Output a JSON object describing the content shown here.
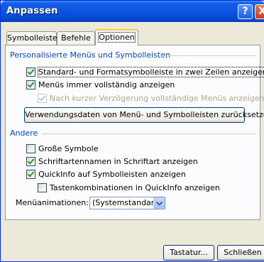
{
  "window": {
    "title": "Anpassen",
    "help_glyph": "?",
    "close_glyph": "X"
  },
  "tabs": [
    {
      "label": "Symbolleisten",
      "active": false
    },
    {
      "label": "Befehle",
      "active": false
    },
    {
      "label": "Optionen",
      "active": true
    }
  ],
  "personalized": {
    "heading": "Personalisierte Menüs und Symbolleisten",
    "options": [
      {
        "label": "Standard- und Formatsymbolleiste in zwei Zeilen anzeigen",
        "checked": true,
        "enabled": true
      },
      {
        "label": "Menüs immer vollständig anzeigen",
        "checked": true,
        "enabled": true
      },
      {
        "label": "Nach kurzer Verzögerung vollständige Menüs anzeigen",
        "checked": true,
        "enabled": false
      }
    ],
    "reset_button": "Verwendungsdaten von Menü- und Symbolleisten zurücksetzen"
  },
  "other": {
    "heading": "Andere",
    "options": [
      {
        "label": "Große Symbole",
        "checked": false,
        "enabled": true
      },
      {
        "label": "Schriftartennamen in Schriftart anzeigen",
        "checked": true,
        "enabled": true
      },
      {
        "label": "QuickInfo auf Symbolleisten anzeigen",
        "checked": true,
        "enabled": true
      },
      {
        "label": "Tastenkombinationen in QuickInfo anzeigen",
        "checked": false,
        "enabled": true
      }
    ],
    "menu_animations_label": "Menüanimationen:",
    "menu_animations_value": "(Systemstandard)"
  },
  "footer": {
    "keyboard_button": "Tastatur...",
    "close_button": "Schließen"
  },
  "colors": {
    "titlebar": "#0a55e0",
    "group_heading": "#0046d5",
    "dialog_bg": "#ece9d8"
  }
}
